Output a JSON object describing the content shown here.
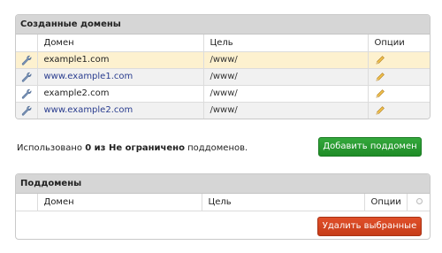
{
  "domains_panel": {
    "title": "Созданные домены",
    "columns": {
      "domain": "Домен",
      "target": "Цель",
      "options": "Опции"
    },
    "rows": [
      {
        "domain": "example1.com",
        "target": "/www/",
        "linked": false
      },
      {
        "domain": "www.example1.com",
        "target": "/www/",
        "linked": true
      },
      {
        "domain": "example2.com",
        "target": "/www/",
        "linked": false
      },
      {
        "domain": "www.example2.com",
        "target": "/www/",
        "linked": true
      }
    ]
  },
  "usage": {
    "prefix": "Использовано",
    "used": "0 из Не ограничено",
    "suffix": "поддоменов."
  },
  "add_subdomain_button": "Добавить поддомен",
  "subdomains_panel": {
    "title": "Поддомены",
    "columns": {
      "domain": "Домен",
      "target": "Цель",
      "options": "Опции"
    }
  },
  "delete_selected_button": "Удалить выбранные",
  "colors": {
    "add_button": "#24962d",
    "delete_button": "#d2451f",
    "highlight_row": "#fdf1cf",
    "link": "#2a3d8f"
  },
  "icons": {
    "row_icon": "wrench-icon",
    "edit_icon": "pencil-icon",
    "select_all": "circle-checkbox-icon"
  }
}
